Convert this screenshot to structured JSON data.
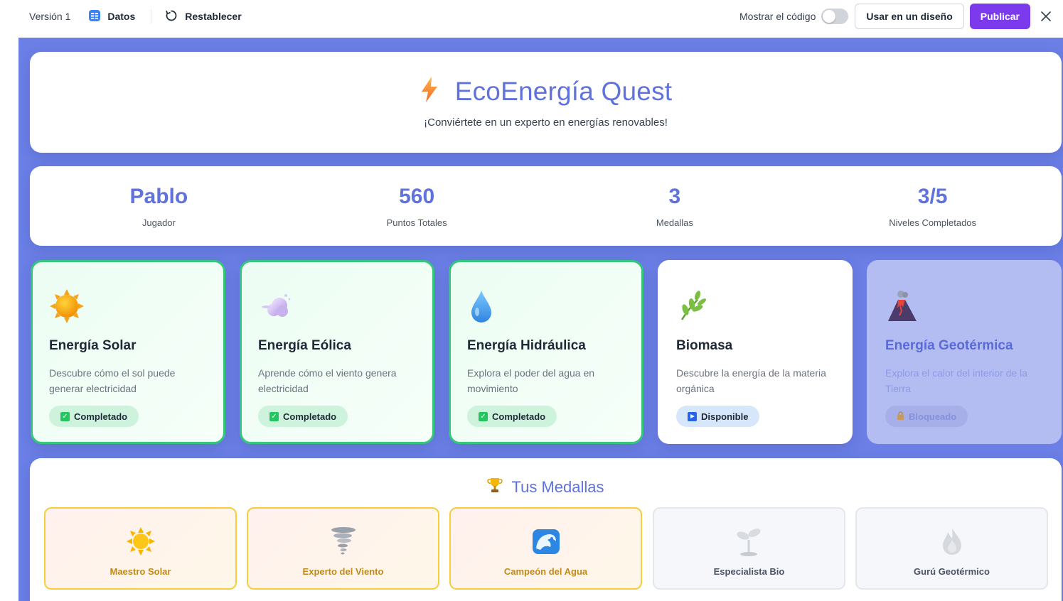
{
  "toolbar": {
    "version": "Versión 1",
    "data_label": "Datos",
    "reset_label": "Restablecer",
    "show_code_label": "Mostrar el código",
    "use_in_design_label": "Usar en un diseño",
    "publish_label": "Publicar"
  },
  "header": {
    "title": "EcoEnergía Quest",
    "subtitle": "¡Conviértete en un experto en energías renovables!",
    "icon": "lightning-icon"
  },
  "stats": [
    {
      "value": "Pablo",
      "label": "Jugador"
    },
    {
      "value": "560",
      "label": "Puntos Totales"
    },
    {
      "value": "3",
      "label": "Medallas"
    },
    {
      "value": "3/5",
      "label": "Niveles Completados"
    }
  ],
  "levels": [
    {
      "title": "Energía Solar",
      "description": "Descubre cómo el sol puede generar electricidad",
      "status": "Completado",
      "icon": "sun-icon"
    },
    {
      "title": "Energía Eólica",
      "description": "Aprende cómo el viento genera electricidad",
      "status": "Completado",
      "icon": "wind-icon"
    },
    {
      "title": "Energía Hidráulica",
      "description": "Explora el poder del agua en movimiento",
      "status": "Completado",
      "icon": "water-drop-icon"
    },
    {
      "title": "Biomasa",
      "description": "Descubre la energía de la materia orgánica",
      "status": "Disponible",
      "icon": "herb-icon"
    },
    {
      "title": "Energía Geotérmica",
      "description": "Explora el calor del interior de la Tierra",
      "status": "Bloqueado",
      "icon": "volcano-icon"
    }
  ],
  "medals": {
    "title": "Tus Medallas",
    "items": [
      {
        "name": "Maestro Solar",
        "earned": true,
        "icon": "sun-burst-icon"
      },
      {
        "name": "Experto del Viento",
        "earned": true,
        "icon": "tornado-icon"
      },
      {
        "name": "Campeón del Agua",
        "earned": true,
        "icon": "wave-icon"
      },
      {
        "name": "Especialista Bio",
        "earned": false,
        "icon": "seedling-icon"
      },
      {
        "name": "Gurú Geotérmico",
        "earned": false,
        "icon": "flame-icon"
      }
    ]
  },
  "colors": {
    "accent": "#6072dc",
    "background": "#6b7fe6",
    "primary_button": "#7c3aed",
    "completed_border": "#34c77b",
    "medal_border": "#f5cd3d"
  }
}
